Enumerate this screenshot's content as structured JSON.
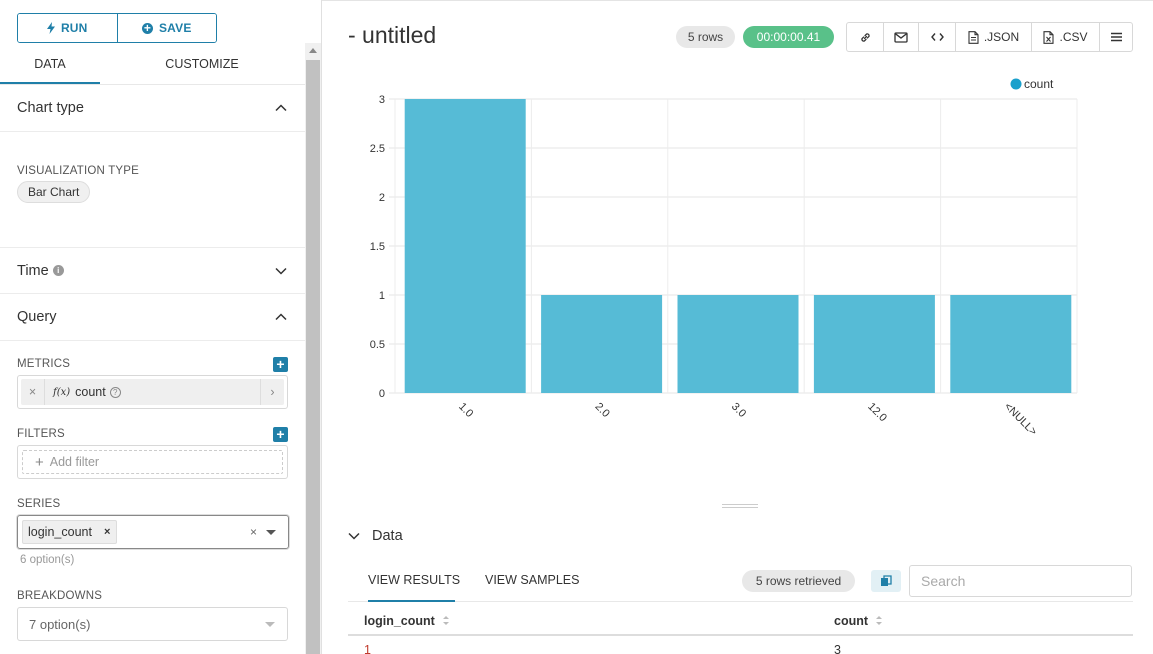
{
  "toolbar": {
    "run_label": "RUN",
    "save_label": "SAVE"
  },
  "left_tabs": [
    {
      "label": "DATA"
    },
    {
      "label": "CUSTOMIZE"
    }
  ],
  "sections": {
    "chart_type": {
      "title": "Chart type",
      "viz_label": "VISUALIZATION TYPE",
      "viz_value": "Bar Chart"
    },
    "time": {
      "title": "Time"
    },
    "query": {
      "title": "Query",
      "metrics_label": "METRICS",
      "metric_name": "count",
      "metric_fx": "f(x)",
      "filters_label": "FILTERS",
      "add_filter": "Add filter",
      "series_label": "SERIES",
      "series_value": "login_count",
      "series_hint": "6 option(s)",
      "breakdowns_label": "BREAKDOWNS",
      "breakdowns_value": "7 option(s)"
    }
  },
  "header": {
    "title": "- untitled",
    "rows_badge": "5 rows",
    "time_badge": "00:00:00.41",
    "json_label": ".JSON",
    "csv_label": ".CSV"
  },
  "chart_data": {
    "type": "bar",
    "categories": [
      "1.0",
      "2.0",
      "3.0",
      "12.0",
      "<NULL>"
    ],
    "series": [
      {
        "name": "count",
        "values": [
          3,
          1,
          1,
          1,
          1
        ]
      }
    ],
    "ylim": [
      0,
      3
    ],
    "yticks": [
      "0",
      "0.5",
      "1",
      "1.5",
      "2",
      "2.5",
      "3"
    ],
    "legend": "top-right",
    "color": "#56bbd6",
    "grid": true
  },
  "data_panel": {
    "title": "Data",
    "tabs": [
      {
        "label": "VIEW RESULTS"
      },
      {
        "label": "VIEW SAMPLES"
      }
    ],
    "retrieved": "5 rows retrieved",
    "search_placeholder": "Search",
    "columns": [
      "login_count",
      "count"
    ],
    "rows": [
      [
        "1",
        "3"
      ]
    ]
  }
}
